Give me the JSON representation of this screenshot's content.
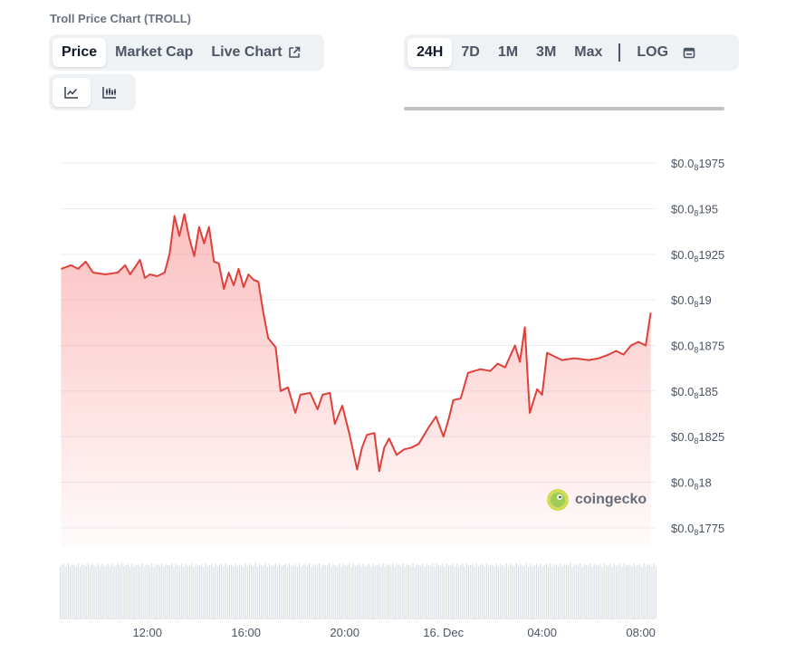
{
  "title": "Troll Price Chart (TROLL)",
  "tabs": [
    {
      "label": "Price",
      "active": true
    },
    {
      "label": "Market Cap",
      "active": false
    },
    {
      "label": "Live Chart",
      "active": false
    }
  ],
  "ranges": [
    {
      "label": "24H",
      "active": true
    },
    {
      "label": "7D",
      "active": false
    },
    {
      "label": "1M",
      "active": false
    },
    {
      "label": "3M",
      "active": false
    },
    {
      "label": "Max",
      "active": false
    }
  ],
  "log_label": "LOG",
  "chart_types": [
    {
      "icon": "line-chart-icon",
      "active": true
    },
    {
      "icon": "candlestick-chart-icon",
      "active": false
    }
  ],
  "watermark": "coingecko",
  "colors": {
    "line": "#e0403a",
    "fill": "#fbd5d3",
    "grid": "#eceef1",
    "volume": "#d7dbe0"
  },
  "chart_data": {
    "type": "area",
    "yticks": [
      {
        "pre": "$0.0",
        "sub": "8",
        "post": "1975",
        "v": 0.1975
      },
      {
        "pre": "$0.0",
        "sub": "8",
        "post": "195",
        "v": 0.195
      },
      {
        "pre": "$0.0",
        "sub": "8",
        "post": "1925",
        "v": 0.1925
      },
      {
        "pre": "$0.0",
        "sub": "8",
        "post": "19",
        "v": 0.19
      },
      {
        "pre": "$0.0",
        "sub": "8",
        "post": "1875",
        "v": 0.1875
      },
      {
        "pre": "$0.0",
        "sub": "8",
        "post": "185",
        "v": 0.185
      },
      {
        "pre": "$0.0",
        "sub": "8",
        "post": "1825",
        "v": 0.1825
      },
      {
        "pre": "$0.0",
        "sub": "8",
        "post": "18",
        "v": 0.18
      },
      {
        "pre": "$0.0",
        "sub": "8",
        "post": "1775",
        "v": 0.1775
      }
    ],
    "ylim": [
      0.1765,
      0.1985
    ],
    "xticks": [
      {
        "label": "12:00",
        "h": 12
      },
      {
        "label": "16:00",
        "h": 16
      },
      {
        "label": "20:00",
        "h": 20
      },
      {
        "label": "16. Dec",
        "h": 24
      },
      {
        "label": "04:00",
        "h": 28
      },
      {
        "label": "08:00",
        "h": 32
      }
    ],
    "xlim": [
      8.45,
      32.6
    ],
    "series": [
      {
        "points": [
          [
            8.5,
            0.1917
          ],
          [
            8.9,
            0.1919
          ],
          [
            9.2,
            0.1917
          ],
          [
            9.5,
            0.1921
          ],
          [
            9.8,
            0.1915
          ],
          [
            10.3,
            0.1914
          ],
          [
            10.8,
            0.1915
          ],
          [
            11.1,
            0.1919
          ],
          [
            11.3,
            0.1914
          ],
          [
            11.7,
            0.1922
          ],
          [
            11.9,
            0.1912
          ],
          [
            12.1,
            0.1914
          ],
          [
            12.4,
            0.1913
          ],
          [
            12.7,
            0.1915
          ],
          [
            12.9,
            0.1925
          ],
          [
            13.1,
            0.1946
          ],
          [
            13.3,
            0.1935
          ],
          [
            13.5,
            0.1947
          ],
          [
            13.7,
            0.1934
          ],
          [
            13.9,
            0.1924
          ],
          [
            14.1,
            0.194
          ],
          [
            14.3,
            0.1931
          ],
          [
            14.5,
            0.194
          ],
          [
            14.7,
            0.1921
          ],
          [
            14.9,
            0.192
          ],
          [
            15.1,
            0.1906
          ],
          [
            15.3,
            0.1915
          ],
          [
            15.5,
            0.1908
          ],
          [
            15.7,
            0.1917
          ],
          [
            15.9,
            0.1907
          ],
          [
            16.1,
            0.1914
          ],
          [
            16.3,
            0.1911
          ],
          [
            16.5,
            0.191
          ],
          [
            16.7,
            0.1893
          ],
          [
            16.9,
            0.1879
          ],
          [
            17.2,
            0.1874
          ],
          [
            17.4,
            0.185
          ],
          [
            17.7,
            0.1852
          ],
          [
            18.0,
            0.1838
          ],
          [
            18.2,
            0.1848
          ],
          [
            18.6,
            0.1849
          ],
          [
            18.9,
            0.184
          ],
          [
            19.1,
            0.1848
          ],
          [
            19.4,
            0.1849
          ],
          [
            19.6,
            0.1832
          ],
          [
            19.9,
            0.1842
          ],
          [
            20.2,
            0.1826
          ],
          [
            20.5,
            0.1807
          ],
          [
            20.7,
            0.1819
          ],
          [
            20.9,
            0.1826
          ],
          [
            21.2,
            0.1827
          ],
          [
            21.4,
            0.1806
          ],
          [
            21.6,
            0.1819
          ],
          [
            21.8,
            0.1824
          ],
          [
            22.1,
            0.1815
          ],
          [
            22.4,
            0.1818
          ],
          [
            22.7,
            0.1819
          ],
          [
            23.0,
            0.1821
          ],
          [
            23.4,
            0.183
          ],
          [
            23.7,
            0.1836
          ],
          [
            24.0,
            0.1825
          ],
          [
            24.2,
            0.1834
          ],
          [
            24.4,
            0.1845
          ],
          [
            24.7,
            0.1846
          ],
          [
            25.0,
            0.186
          ],
          [
            25.5,
            0.1862
          ],
          [
            25.9,
            0.1861
          ],
          [
            26.2,
            0.1865
          ],
          [
            26.5,
            0.1863
          ],
          [
            26.9,
            0.1875
          ],
          [
            27.1,
            0.1866
          ],
          [
            27.3,
            0.1885
          ],
          [
            27.5,
            0.1838
          ],
          [
            27.8,
            0.1851
          ],
          [
            28.0,
            0.1848
          ],
          [
            28.2,
            0.1871
          ],
          [
            28.5,
            0.1869
          ],
          [
            28.8,
            0.1867
          ],
          [
            29.3,
            0.1868
          ],
          [
            29.9,
            0.1867
          ],
          [
            30.3,
            0.1868
          ],
          [
            30.7,
            0.187
          ],
          [
            31.0,
            0.1872
          ],
          [
            31.3,
            0.187
          ],
          [
            31.6,
            0.1875
          ],
          [
            31.9,
            0.1877
          ],
          [
            32.2,
            0.1875
          ],
          [
            32.4,
            0.1893
          ]
        ]
      }
    ]
  }
}
